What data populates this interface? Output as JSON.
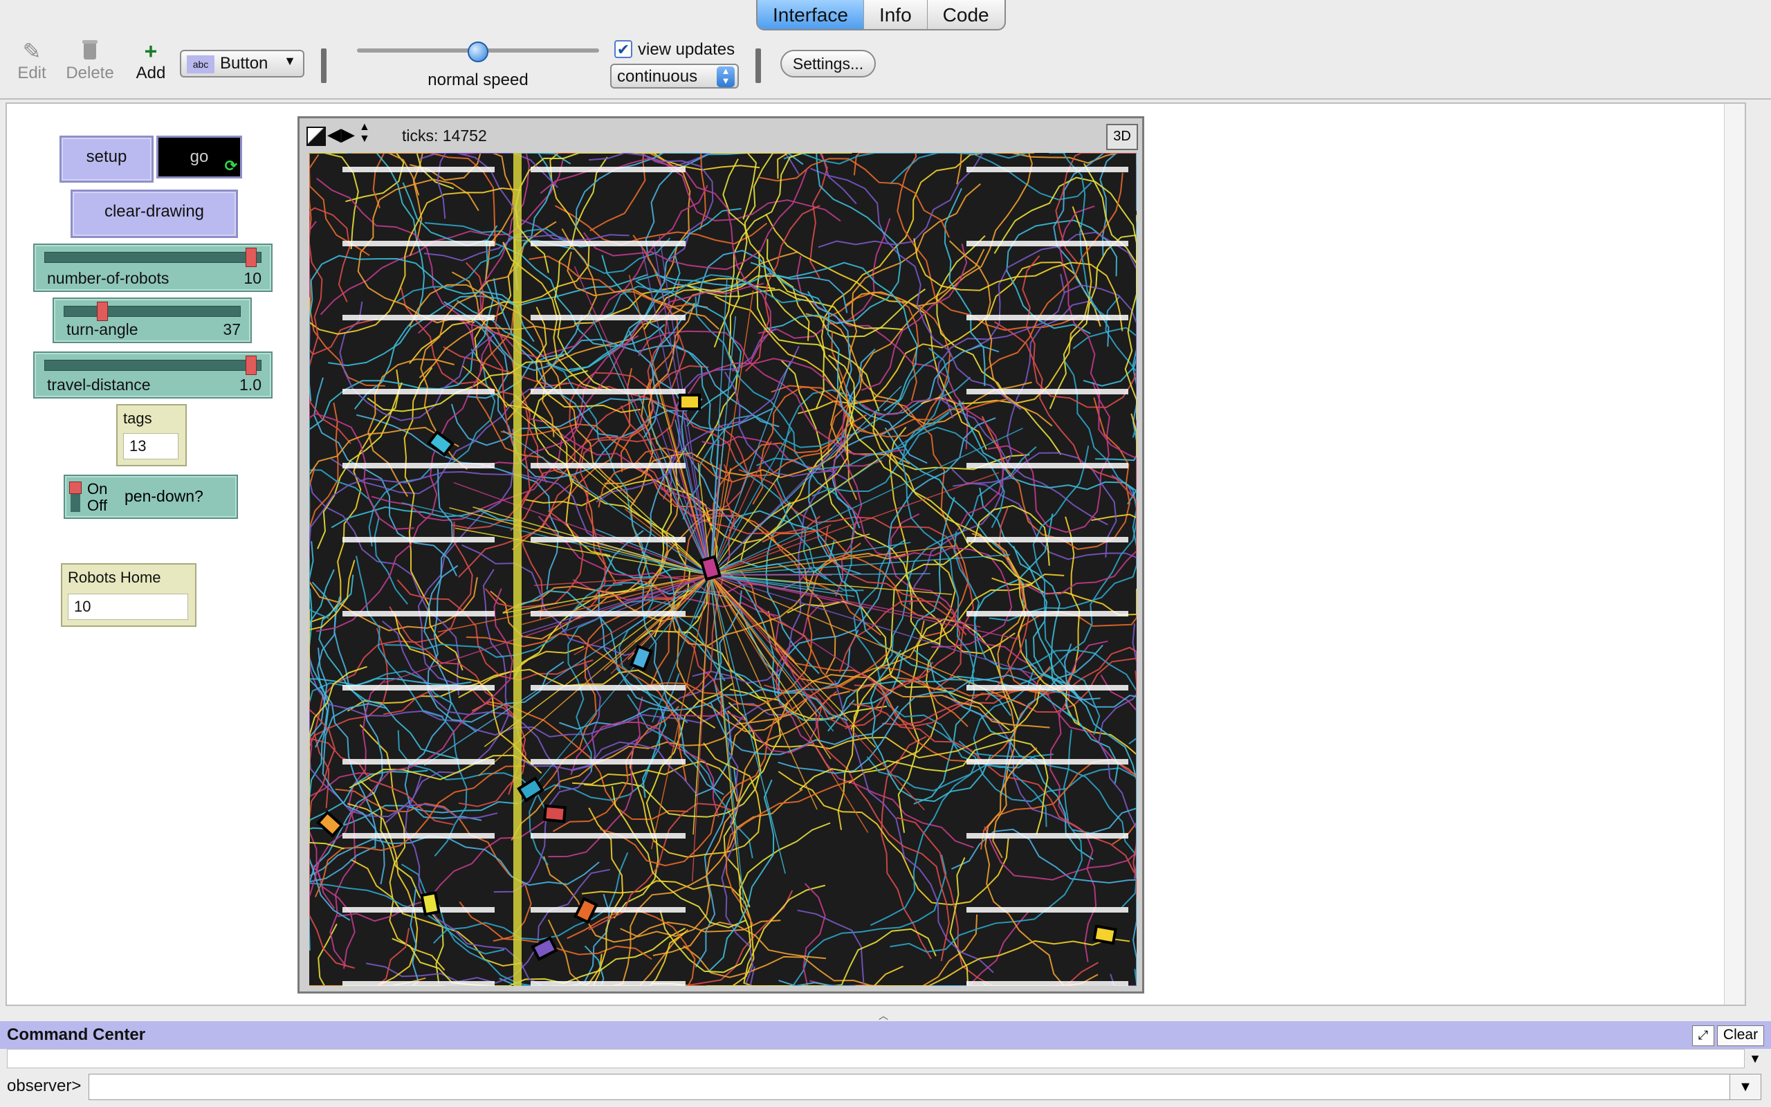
{
  "tabs": [
    {
      "label": "Interface",
      "active": true
    },
    {
      "label": "Info",
      "active": false
    },
    {
      "label": "Code",
      "active": false
    }
  ],
  "toolbar": {
    "edit_label": "Edit",
    "delete_label": "Delete",
    "add_label": "Add",
    "widget_type": "Button",
    "widget_type_prefix": "abc",
    "speed_label": "normal speed",
    "speed_level": 0.5,
    "view_updates_label": "view updates",
    "view_updates_checked": true,
    "update_mode": "continuous",
    "settings_label": "Settings..."
  },
  "widgets": {
    "setup_label": "setup",
    "go_label": "go",
    "clear_drawing_label": "clear-drawing",
    "number_of_robots": {
      "label": "number-of-robots",
      "value": "10",
      "fraction": 0.97
    },
    "turn_angle": {
      "label": "turn-angle",
      "value": "37",
      "fraction": 0.2
    },
    "travel_distance": {
      "label": "travel-distance",
      "value": "1.0",
      "fraction": 0.97
    },
    "tags_monitor": {
      "label": "tags",
      "value": "13"
    },
    "pen_down_switch": {
      "on_label": "On",
      "off_label": "Off",
      "label": "pen-down?"
    },
    "robots_home_monitor": {
      "label": "Robots Home",
      "value": "10"
    }
  },
  "view": {
    "ticks_text": "ticks: 14752",
    "three_d_label": "3D"
  },
  "command_center": {
    "title": "Command Center",
    "clear_label": "Clear",
    "prompt": "observer>",
    "input_value": ""
  },
  "colors": {
    "tab_active": "#5aa5f2",
    "button_purple": "#babaf0",
    "slider_green": "#8ec7b8",
    "monitor_tan": "#e8e8c0",
    "world_bg": "#1c1c1c",
    "command_bar": "#b9b9ee"
  }
}
